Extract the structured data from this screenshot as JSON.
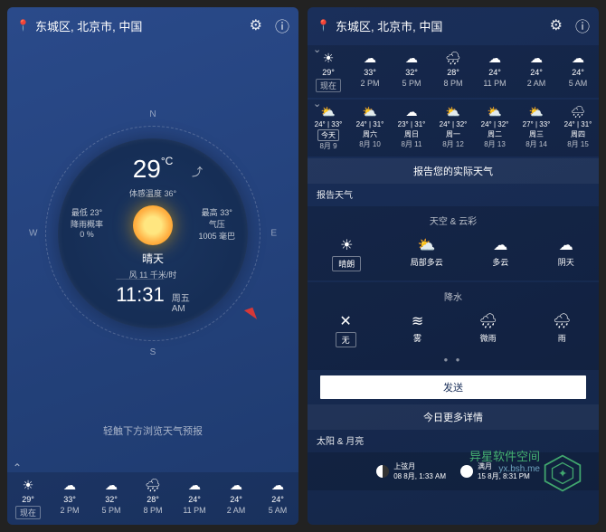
{
  "location": "东城区, 北京市, 中国",
  "cardinals": {
    "n": "N",
    "s": "S",
    "e": "E",
    "w": "W"
  },
  "current": {
    "temp": "29",
    "unit": "°C",
    "feels_label": "体感温度",
    "feels_value": "36°",
    "low_label": "最低",
    "low_value": "23°",
    "high_label": "最高",
    "high_value": "33°",
    "precip_label": "降雨概率",
    "precip_value": "0 %",
    "pressure_label": "气压",
    "pressure_value": "1005 毫巴",
    "condition": "晴天",
    "wind": "风 11 千米/时",
    "time": "11:31",
    "day": "周五",
    "ampm": "AM"
  },
  "hint": "轻触下方浏览天气预报",
  "hourly": [
    {
      "icon": "☀",
      "temp": "29°",
      "hour": "现在",
      "now": true
    },
    {
      "icon": "☁",
      "temp": "33°",
      "hour": "2 PM"
    },
    {
      "icon": "☁",
      "temp": "32°",
      "hour": "5 PM"
    },
    {
      "icon": "🌧",
      "temp": "28°",
      "hour": "8 PM"
    },
    {
      "icon": "☁",
      "temp": "24°",
      "hour": "11 PM"
    },
    {
      "icon": "☁",
      "temp": "24°",
      "hour": "2 AM"
    },
    {
      "icon": "☁",
      "temp": "24°",
      "hour": "5 AM"
    }
  ],
  "daily": [
    {
      "icon": "⛅",
      "range": "24° | 33°",
      "dow": "今天",
      "date": "8月 9",
      "today": true
    },
    {
      "icon": "⛅",
      "range": "24° | 31°",
      "dow": "周六",
      "date": "8月 10"
    },
    {
      "icon": "☁",
      "range": "23° | 31°",
      "dow": "周日",
      "date": "8月 11"
    },
    {
      "icon": "⛅",
      "range": "24° | 32°",
      "dow": "周一",
      "date": "8月 12"
    },
    {
      "icon": "⛅",
      "range": "24° | 32°",
      "dow": "周二",
      "date": "8月 13"
    },
    {
      "icon": "⛅",
      "range": "27° | 33°",
      "dow": "周三",
      "date": "8月 14"
    },
    {
      "icon": "🌧",
      "range": "24° | 31°",
      "dow": "周四",
      "date": "8月 15"
    }
  ],
  "report": {
    "banner": "报告您的实际天气",
    "title": "报告天气",
    "sky_label": "天空 & 云彩",
    "sky": [
      {
        "icon": "☀",
        "label": "晴朗",
        "selected": true
      },
      {
        "icon": "⛅",
        "label": "局部多云"
      },
      {
        "icon": "☁",
        "label": "多云"
      },
      {
        "icon": "☁",
        "label": "阴天"
      }
    ],
    "precip_label": "降水",
    "precip": [
      {
        "icon": "✕",
        "label": "无",
        "selected": true
      },
      {
        "icon": "≋",
        "label": "雾"
      },
      {
        "icon": "🌧",
        "label": "微雨"
      },
      {
        "icon": "🌧",
        "label": "雨"
      }
    ],
    "send": "发送"
  },
  "more_today": "今日更多详情",
  "sunmoon": {
    "title": "太阳 & 月亮",
    "phases": [
      {
        "name": "上弦月",
        "date": "08 8月, 1:33 AM",
        "type": "half"
      },
      {
        "name": "满月",
        "date": "15 8月, 8:31 PM",
        "type": "full"
      }
    ]
  },
  "watermark": {
    "title": "异星软件空间",
    "url": "yx.bsh.me"
  }
}
